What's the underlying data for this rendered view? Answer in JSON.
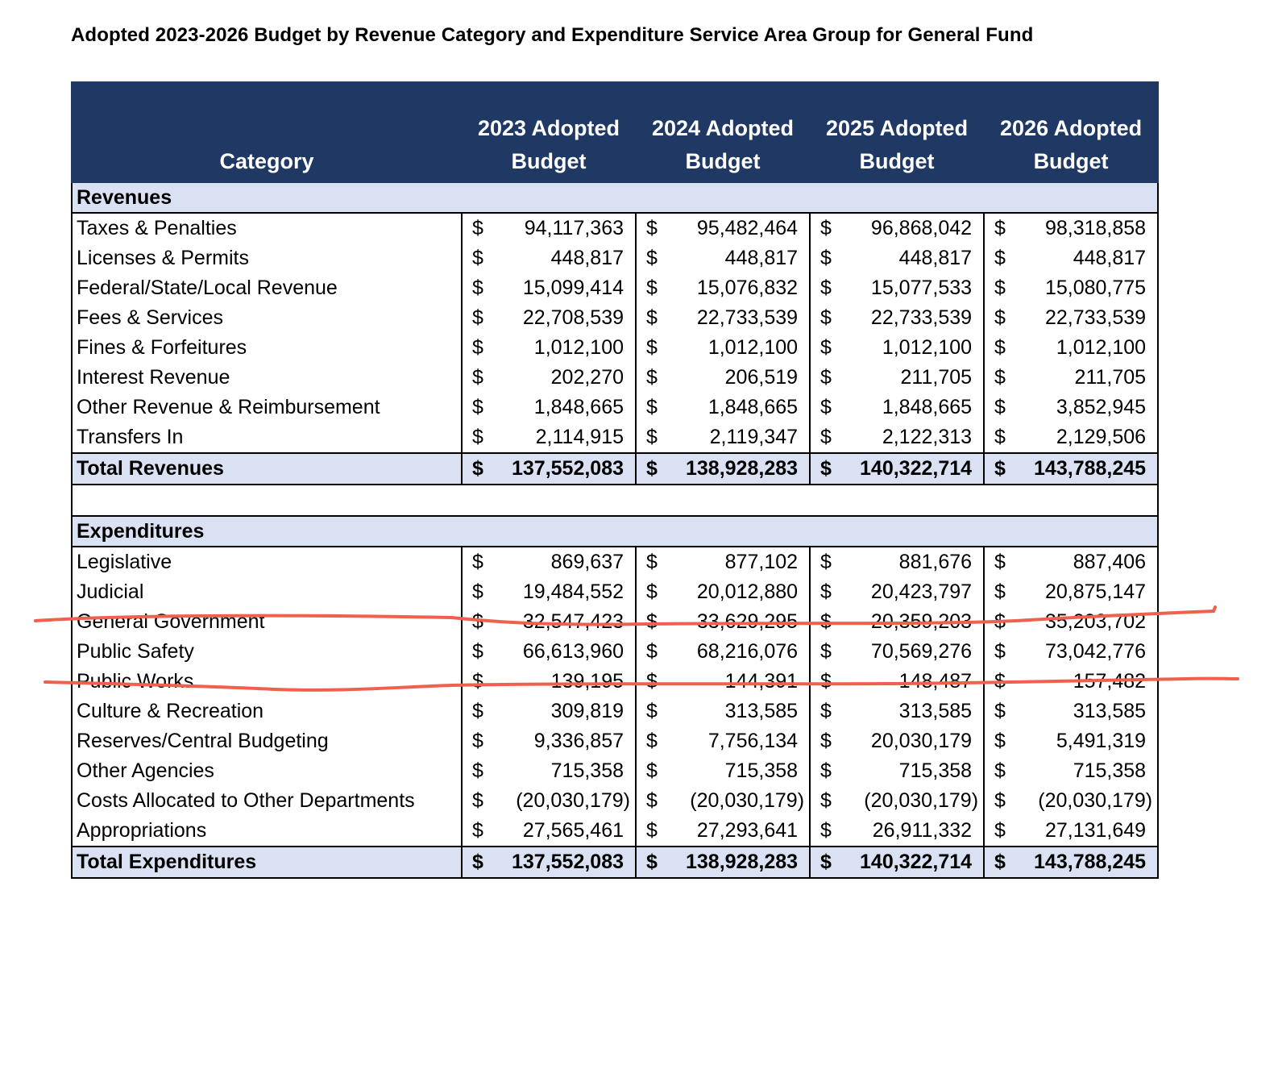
{
  "title": "Adopted 2023-2026 Budget by Revenue Category and Expenditure Service Area Group for General Fund",
  "header": {
    "category": "Category",
    "years": [
      {
        "line1": "2023 Adopted",
        "line2": "Budget"
      },
      {
        "line1": "2024 Adopted",
        "line2": "Budget"
      },
      {
        "line1": "2025 Adopted",
        "line2": "Budget"
      },
      {
        "line1": "2026 Adopted",
        "line2": "Budget"
      }
    ]
  },
  "currency_symbol": "$",
  "revenues": {
    "section_label": "Revenues",
    "rows": [
      {
        "category": "Taxes & Penalties",
        "values": [
          "94,117,363",
          "95,482,464",
          "96,868,042",
          "98,318,858"
        ]
      },
      {
        "category": "Licenses & Permits",
        "values": [
          "448,817",
          "448,817",
          "448,817",
          "448,817"
        ]
      },
      {
        "category": "Federal/State/Local Revenue",
        "values": [
          "15,099,414",
          "15,076,832",
          "15,077,533",
          "15,080,775"
        ]
      },
      {
        "category": "Fees & Services",
        "values": [
          "22,708,539",
          "22,733,539",
          "22,733,539",
          "22,733,539"
        ]
      },
      {
        "category": "Fines & Forfeitures",
        "values": [
          "1,012,100",
          "1,012,100",
          "1,012,100",
          "1,012,100"
        ]
      },
      {
        "category": "Interest Revenue",
        "values": [
          "202,270",
          "206,519",
          "211,705",
          "211,705"
        ]
      },
      {
        "category": "Other Revenue & Reimbursement",
        "values": [
          "1,848,665",
          "1,848,665",
          "1,848,665",
          "3,852,945"
        ]
      },
      {
        "category": "Transfers In",
        "values": [
          "2,114,915",
          "2,119,347",
          "2,122,313",
          "2,129,506"
        ]
      }
    ],
    "total": {
      "category": "Total Revenues",
      "values": [
        "137,552,083",
        "138,928,283",
        "140,322,714",
        "143,788,245"
      ]
    }
  },
  "expenditures": {
    "section_label": "Expenditures",
    "rows": [
      {
        "category": "Legislative",
        "values": [
          "869,637",
          "877,102",
          "881,676",
          "887,406"
        ]
      },
      {
        "category": "Judicial",
        "values": [
          "19,484,552",
          "20,012,880",
          "20,423,797",
          "20,875,147"
        ]
      },
      {
        "category": "General Government",
        "values": [
          "32,547,423",
          "33,629,295",
          "20,359,203",
          "35,203,702"
        ]
      },
      {
        "category": "Public Safety",
        "values": [
          "66,613,960",
          "68,216,076",
          "70,569,276",
          "73,042,776"
        ]
      },
      {
        "category": "Public Works",
        "values": [
          "139,195",
          "144,391",
          "148,487",
          "157,482"
        ]
      },
      {
        "category": "Culture & Recreation",
        "values": [
          "309,819",
          "313,585",
          "313,585",
          "313,585"
        ]
      },
      {
        "category": "Reserves/Central Budgeting",
        "values": [
          "9,336,857",
          "7,756,134",
          "20,030,179",
          "5,491,319"
        ]
      },
      {
        "category": "Other Agencies",
        "values": [
          "715,358",
          "715,358",
          "715,358",
          "715,358"
        ]
      },
      {
        "category": "Costs Allocated to Other Departments",
        "values": [
          "(20,030,179)",
          "(20,030,179)",
          "(20,030,179)",
          "(20,030,179)"
        ]
      },
      {
        "category": "Appropriations",
        "values": [
          "27,565,461",
          "27,293,641",
          "26,911,332",
          "27,131,649"
        ]
      }
    ],
    "total": {
      "category": "Total Expenditures",
      "values": [
        "137,552,083",
        "138,928,283",
        "140,322,714",
        "143,788,245"
      ]
    }
  },
  "annotation_color": "#f0604e"
}
